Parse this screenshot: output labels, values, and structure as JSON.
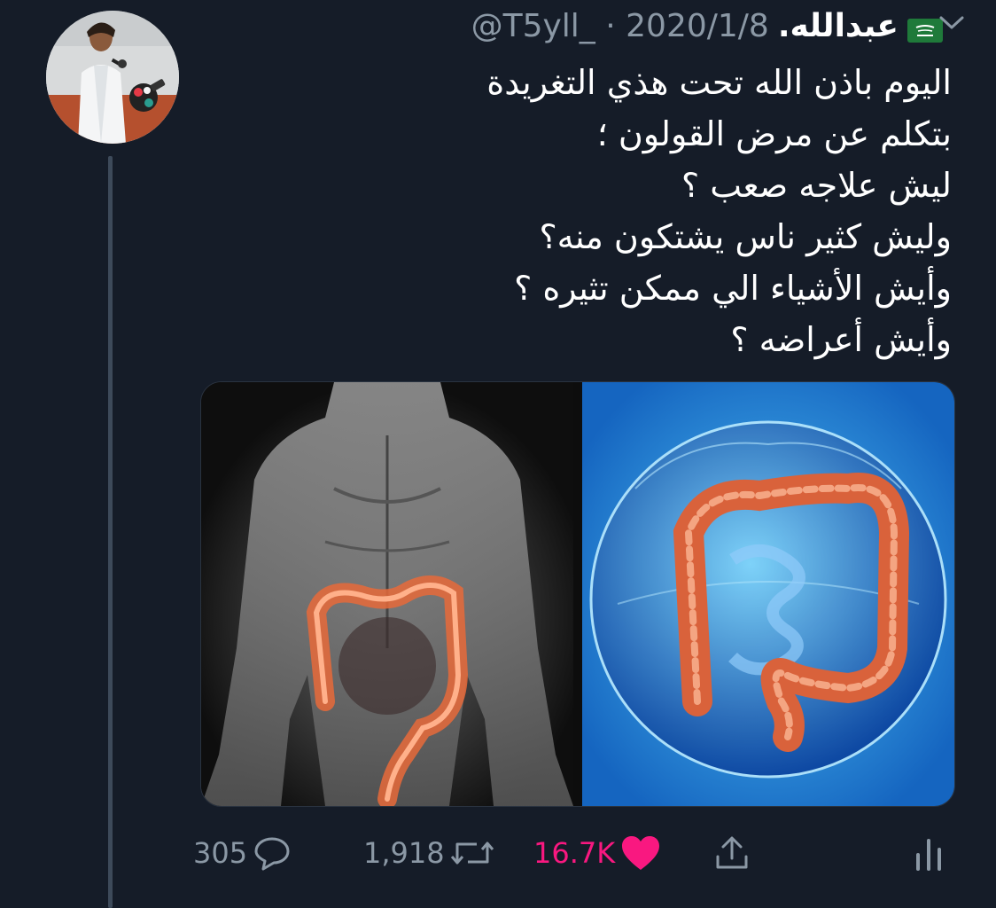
{
  "tweet": {
    "display_name": "عبدالله.",
    "handle": "@T5yll_",
    "separator": "·",
    "date": "2020/1/8",
    "flag_icon": "saudi-flag-icon",
    "lines": [
      "اليوم باذن الله تحت هذي التغريدة",
      "بتكلم عن مرض القولون ؛",
      "ليش علاجه صعب ؟",
      "وليش كثير ناس يشتكون منه؟",
      "وأيش الأشياء الي ممكن تثيره  ؟",
      "وأيش أعراضه ؟"
    ]
  },
  "stats": {
    "replies": "305",
    "retweets": "1,918",
    "likes": "16.7K"
  },
  "colors": {
    "background": "#151c28",
    "muted": "#8b98a5",
    "like_pink": "#f91880",
    "thread_line": "#3d4a5a"
  },
  "icons": {
    "reply": "reply-icon",
    "retweet": "retweet-icon",
    "like": "heart-icon",
    "share": "share-icon",
    "analytics": "analytics-icon",
    "more": "chevron-down-icon"
  }
}
